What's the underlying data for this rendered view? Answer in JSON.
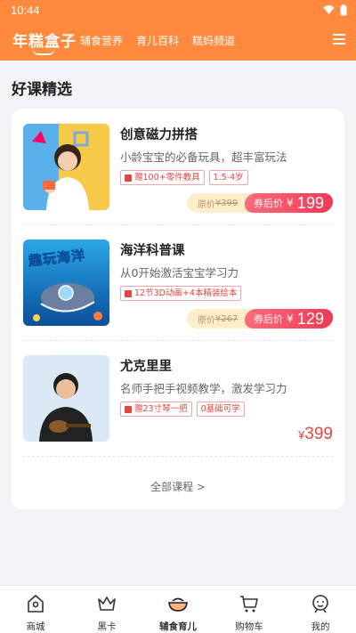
{
  "status": {
    "time": "10:44"
  },
  "appbar": {
    "logo": "年糕盒子",
    "nav": [
      "辅食营养",
      "育儿百科",
      "糕妈频道"
    ]
  },
  "section": {
    "title": "好课精选"
  },
  "courses": [
    {
      "title": "创意磁力拼搭",
      "desc": "小龄宝宝的必备玩具，超丰富玩法",
      "tags": [
        "赠100+零件教具",
        "1.5-4岁"
      ],
      "orig_label": "原价",
      "orig_price": "¥399",
      "after_label": "券后价",
      "yen": "¥",
      "price": "199"
    },
    {
      "title": "海洋科普课",
      "desc": "从0开始激活宝宝学习力",
      "tags": [
        "12节3D动画+4本精装绘本"
      ],
      "orig_label": "原价",
      "orig_price": "¥267",
      "after_label": "券后价",
      "yen": "¥",
      "price": "129"
    },
    {
      "title": "尤克里里",
      "desc": "名师手把手视频教学，激发学习力",
      "tags": [
        "赠23寸琴一把",
        "0基础可学"
      ],
      "yen": "¥",
      "price": "399"
    }
  ],
  "all_courses": "全部课程 >",
  "thumb_texts": {
    "ocean": "趣玩海洋"
  },
  "tabbar": [
    {
      "label": "商城",
      "icon": "home-icon"
    },
    {
      "label": "黑卡",
      "icon": "crown-icon"
    },
    {
      "label": "辅食育儿",
      "icon": "bowl-icon"
    },
    {
      "label": "购物车",
      "icon": "cart-icon"
    },
    {
      "label": "我的",
      "icon": "profile-icon"
    }
  ],
  "colors": {
    "brand": "#ff8a3d",
    "price_red": "#e0463f",
    "coupon_pink": "#f03a55"
  }
}
